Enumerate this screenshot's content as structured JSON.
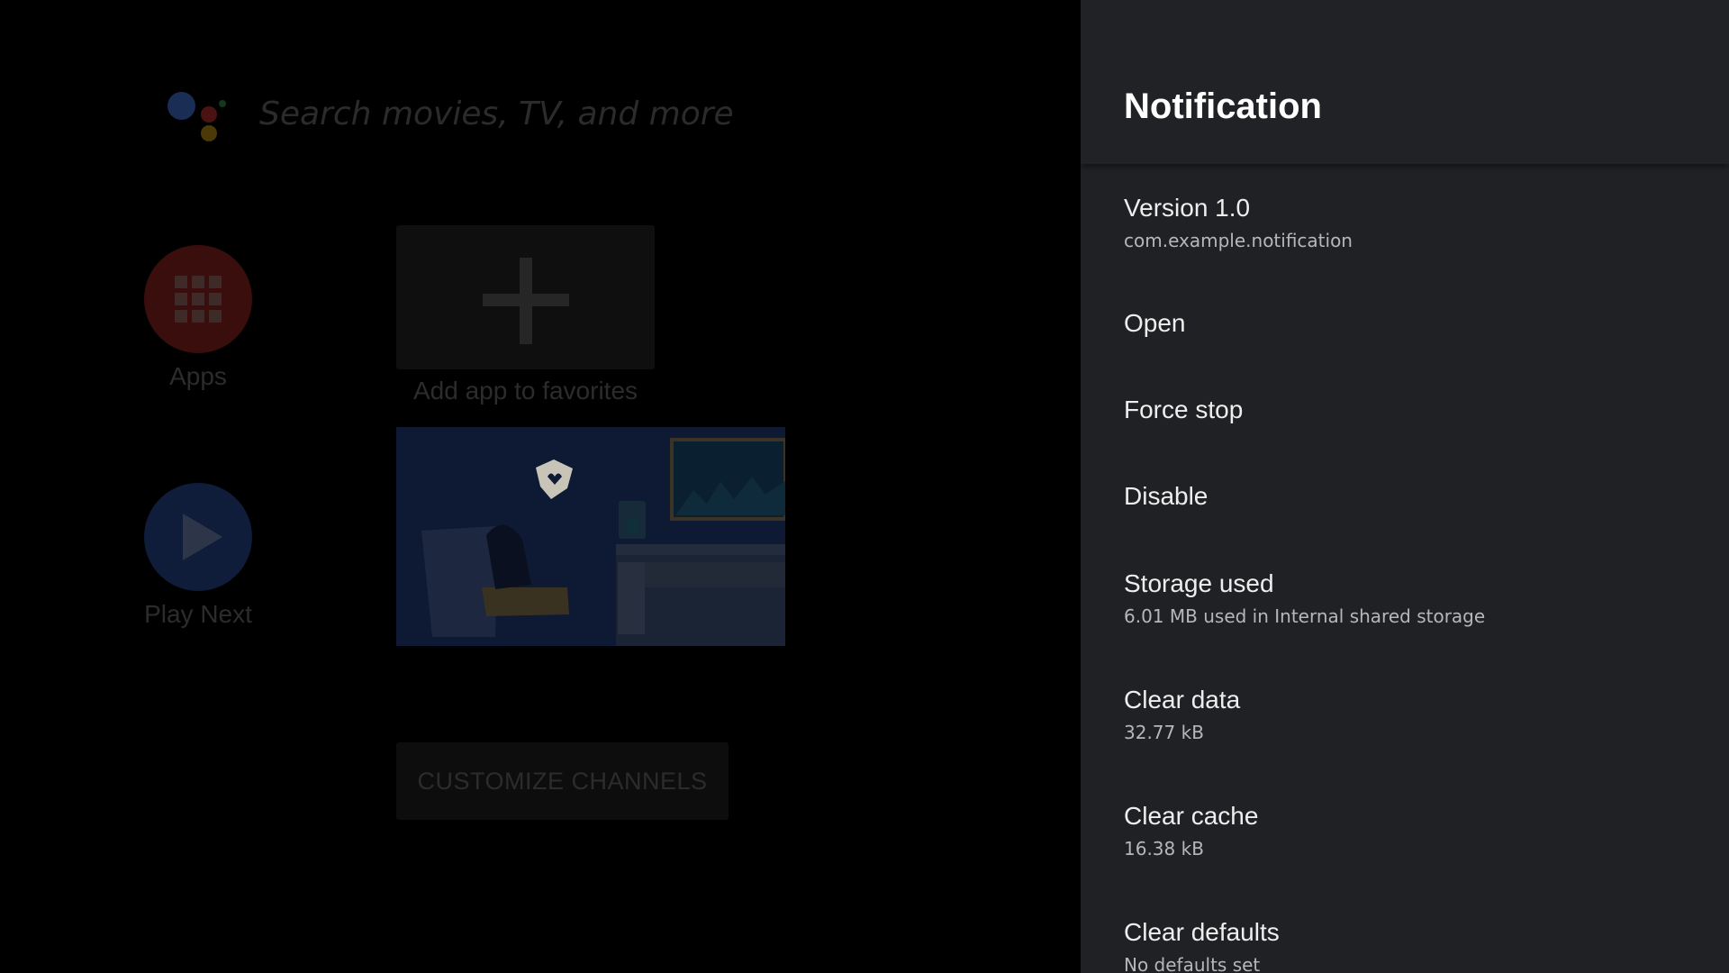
{
  "launcher": {
    "search_placeholder": "Search movies, TV, and more",
    "apps_label": "Apps",
    "play_next_label": "Play Next",
    "add_favorites_label": "Add app to favorites",
    "customize_channels_label": "CUSTOMIZE CHANNELS"
  },
  "panel": {
    "title": "Notification",
    "items": [
      {
        "title": "Version 1.0",
        "subtitle": "com.example.notification"
      },
      {
        "title": "Open",
        "subtitle": ""
      },
      {
        "title": "Force stop",
        "subtitle": ""
      },
      {
        "title": "Disable",
        "subtitle": ""
      },
      {
        "title": "Storage used",
        "subtitle": "6.01 MB used in Internal shared storage"
      },
      {
        "title": "Clear data",
        "subtitle": "32.77 kB"
      },
      {
        "title": "Clear cache",
        "subtitle": "16.38 kB"
      },
      {
        "title": "Clear defaults",
        "subtitle": "No defaults set"
      }
    ]
  },
  "colors": {
    "panel_background": "#202124",
    "overlay_dim": "#000000",
    "text_primary": "#eeeeee",
    "text_secondary": "#b7b7b9"
  }
}
